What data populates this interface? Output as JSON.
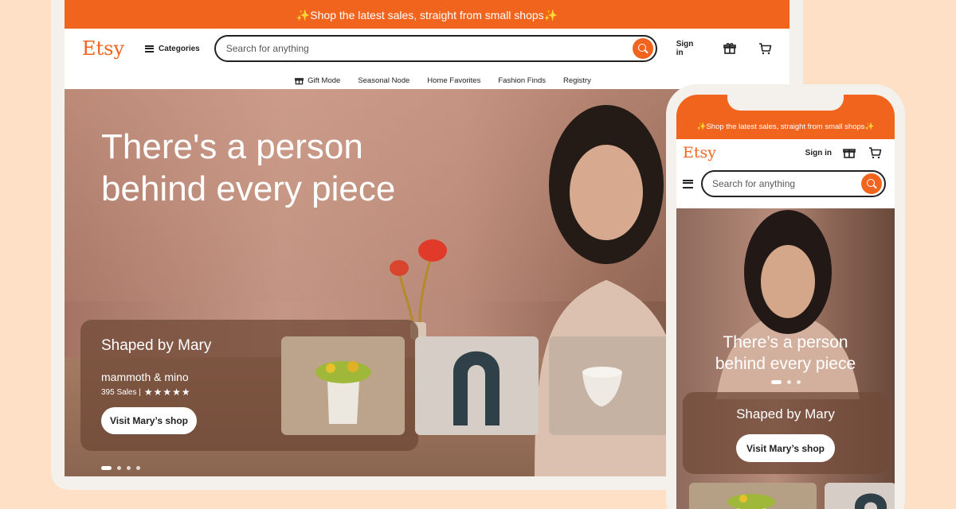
{
  "colors": {
    "brand": "#f1641e",
    "background": "#fde0c6",
    "text": "#222222"
  },
  "desktop": {
    "promo_text": "✨Shop the latest sales, straight from small shops✨",
    "logo": "Etsy",
    "categories_label": "Categories",
    "search": {
      "placeholder": "Search for anything",
      "icon": "search-icon"
    },
    "sign_in_label": "Sign in",
    "header_icons": [
      "gift-icon",
      "cart-icon"
    ],
    "nav_items": [
      {
        "label": "Gift Mode",
        "icon": "gift-icon"
      },
      {
        "label": "Seasonal Node"
      },
      {
        "label": "Home Favorites"
      },
      {
        "label": "Fashion Finds"
      },
      {
        "label": "Registry"
      }
    ],
    "hero": {
      "title_line1": "There's a person",
      "title_line2": "behind every piece",
      "shop_card": {
        "title": "Shaped by Mary",
        "shop_handle": "mammoth & mino",
        "sales": "395 Sales |",
        "rating_stars": 5,
        "stars_text": "★★★★★",
        "button_label": "Visit Mary’s shop"
      },
      "carousel": {
        "count": 4,
        "active_index": 0
      }
    }
  },
  "mobile": {
    "promo_text": "✨Shop the latest sales, straight from small shops✨",
    "logo": "Etsy",
    "sign_in_label": "Sign in",
    "header_icons": [
      "gift-icon",
      "cart-icon",
      "menu-icon"
    ],
    "search": {
      "placeholder": "Search for anything",
      "icon": "search-icon"
    },
    "hero": {
      "title_line1": "There’s a person",
      "title_line2": "behind every piece",
      "carousel": {
        "count": 3,
        "active_index": 0
      },
      "shop_card": {
        "title": "Shaped by Mary",
        "button_label": "Visit Mary’s shop"
      }
    }
  }
}
